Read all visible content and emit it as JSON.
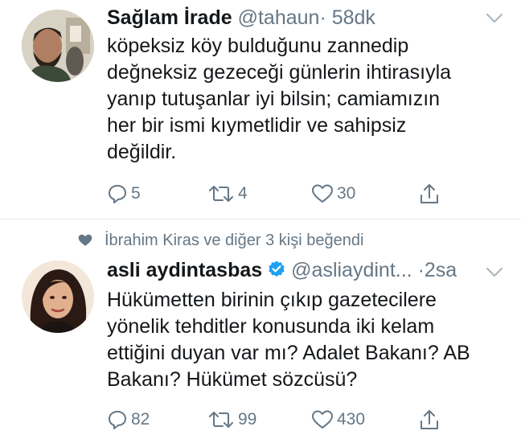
{
  "tweets": [
    {
      "name": "Sağlam İrade",
      "handle": "@tahaun",
      "separator": "·",
      "time": "58dk",
      "text_lines": [
        "köpeksiz köy bulduğunu zannedip",
        "değneksiz gezeceği günlerin ihtirasıyla",
        "yanıp tutuşanlar iyi bilsin; camiamızın",
        "her bir ismi kıymetlidir ve sahipsiz",
        "değildir."
      ],
      "replies": "5",
      "retweets": "4",
      "likes": "30"
    },
    {
      "social_context": "İbrahim Kiras ve diğer 3 kişi beğendi",
      "name": "asli aydintasbas",
      "handle": "@asliaydint...",
      "separator": "·",
      "time": "2sa",
      "verified": true,
      "text_lines": [
        "Hükümetten birinin çıkıp gazetecilere",
        "yönelik tehditler konusunda iki kelam",
        "ettiğini duyan var mı? Adalet Bakanı? AB",
        "Bakanı? Hükümet sözcüsü?"
      ],
      "replies": "82",
      "retweets": "99",
      "likes": "430"
    }
  ],
  "icons": {
    "reply": "reply-icon",
    "retweet": "retweet-icon",
    "like": "heart-icon",
    "share": "share-icon",
    "more": "chevron-down-icon",
    "verified": "verified-badge-icon"
  },
  "colors": {
    "text": "#14171a",
    "secondary": "#657786",
    "verified": "#1da1f2",
    "divider": "#e1e8ed"
  }
}
